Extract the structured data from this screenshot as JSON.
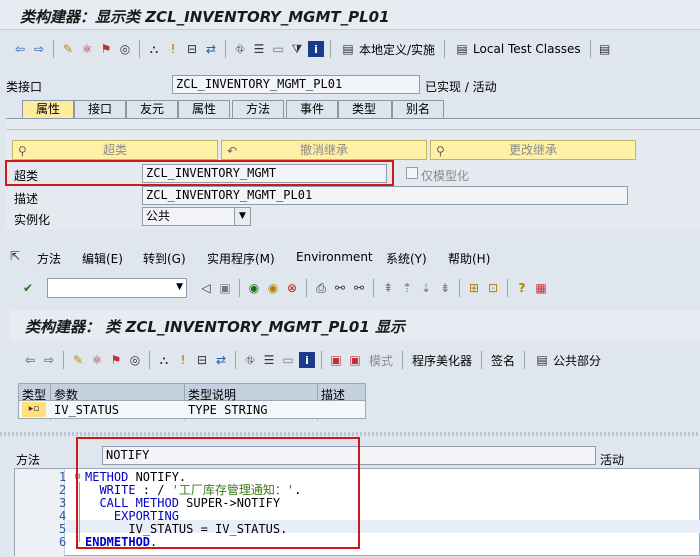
{
  "window": {
    "title": "类构建器：显示类 ZCL_INVENTORY_MGMT_PL01"
  },
  "toolbar1": {
    "local_def_label": "本地定义/实施",
    "local_test_label": "Local Test Classes"
  },
  "header": {
    "class_interface_label": "类接口",
    "class_interface_value": "ZCL_INVENTORY_MGMT_PL01",
    "status_text": "已实现 / 活动"
  },
  "tabs": [
    {
      "label": "属性"
    },
    {
      "label": "接口"
    },
    {
      "label": "友元"
    },
    {
      "label": "属性"
    },
    {
      "label": "方法"
    },
    {
      "label": "事件"
    },
    {
      "label": "类型"
    },
    {
      "label": "别名"
    }
  ],
  "inherit_buttons": {
    "superclass": "超类",
    "undo_inherit": "撤消继承",
    "change_inherit": "更改继承"
  },
  "props": {
    "superclass_label": "超类",
    "superclass_value": "ZCL_INVENTORY_MGMT",
    "model_only_label": "仅模型化",
    "description_label": "描述",
    "description_value": "ZCL_INVENTORY_MGMT_PL01",
    "instantiation_label": "实例化",
    "instantiation_value": "公共"
  },
  "menu": {
    "items": [
      "方法",
      "编辑(E)",
      "转到(G)",
      "实用程序(M)",
      "Environment",
      "系统(Y)",
      "帮助(H)"
    ]
  },
  "inner": {
    "title": "类构建器： 类 ZCL_INVENTORY_MGMT_PL01 显示",
    "mode_label": "模式",
    "pretty_printer_label": "程序美化器",
    "signature_label": "签名",
    "public_section_label": "公共部分"
  },
  "params": {
    "columns": [
      "类型",
      "参数",
      "类型说明",
      "描述"
    ],
    "rows": [
      {
        "name": "IV_STATUS",
        "type": "TYPE STRING",
        "description": ""
      }
    ]
  },
  "method": {
    "label": "方法",
    "name": "NOTIFY",
    "status": "活动"
  },
  "code_lines": {
    "l1": [
      "METHOD",
      " NOTIFY."
    ],
    "l2": [
      "  WRITE",
      " : / ",
      "'工厂库存管理通知：'",
      "."
    ],
    "l3": [
      "  CALL METHOD",
      " SUPER->NOTIFY"
    ],
    "l4": [
      "    EXPORTING"
    ],
    "l5": [
      "      IV_STATUS = IV_STATUS."
    ],
    "l6": [
      "ENDMETHOD",
      "."
    ]
  },
  "colors": {
    "highlight_box": "#d01818",
    "active_tab": "#ffeb9e",
    "keyword": "#0000c8",
    "string": "#3a7a1a"
  }
}
